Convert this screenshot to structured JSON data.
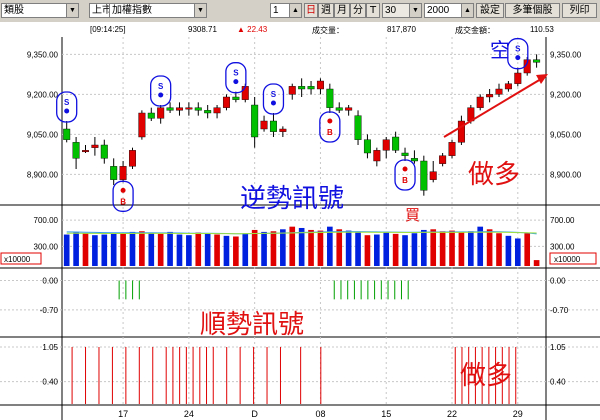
{
  "toolbar": {
    "category_value": "類股",
    "market_value": "上市",
    "index_value": "加權指數",
    "period_num": "1",
    "period_day": "日",
    "period_week": "週",
    "period_month": "月",
    "period_season": "分",
    "period_t": "T",
    "ma_value": "30",
    "count_value": "2000",
    "settings_label": "設定",
    "multi_label": "多筆個股",
    "print_label": "列印"
  },
  "infobar": {
    "time": "[09:14:25]",
    "price": "9308.71",
    "change": "▲ 22.43",
    "volume_label": "成交量：",
    "volume_value": "817,870",
    "amount_label": "成交金額：",
    "amount_value": "110.53"
  },
  "colors": {
    "up": "#e00000",
    "down": "#00c000",
    "vol_blue": "#0020e0",
    "grid": "#c8c8c8",
    "annot_red": "#e01010",
    "annot_blue": "#1010e0"
  },
  "chart_data": {
    "type": "candlestick",
    "price_ticks": [
      "9,350.00",
      "9,200.00",
      "9,050.00",
      "8,900.00"
    ],
    "price_tick_values": [
      9350,
      9200,
      9050,
      8900
    ],
    "price_range": [
      8800,
      9400
    ],
    "x_labels": [
      "17",
      "24",
      "D",
      "08",
      "15",
      "22",
      "29"
    ],
    "x_label_index": [
      6,
      13,
      20,
      27,
      34,
      41,
      48
    ],
    "candles": [
      [
        9070,
        9100,
        9020,
        9030
      ],
      [
        9020,
        9040,
        8920,
        8960
      ],
      [
        8990,
        9010,
        8980,
        8990
      ],
      [
        9000,
        9040,
        8970,
        9010
      ],
      [
        9010,
        9030,
        8940,
        8960
      ],
      [
        8930,
        8960,
        8860,
        8880
      ],
      [
        8880,
        8950,
        8870,
        8930
      ],
      [
        8930,
        9000,
        8920,
        8990
      ],
      [
        9040,
        9140,
        9030,
        9130
      ],
      [
        9130,
        9150,
        9100,
        9110
      ],
      [
        9110,
        9160,
        9090,
        9150
      ],
      [
        9150,
        9170,
        9130,
        9140
      ],
      [
        9140,
        9170,
        9120,
        9150
      ],
      [
        9150,
        9170,
        9120,
        9150
      ],
      [
        9150,
        9170,
        9120,
        9140
      ],
      [
        9140,
        9160,
        9110,
        9130
      ],
      [
        9130,
        9160,
        9110,
        9150
      ],
      [
        9150,
        9200,
        9140,
        9190
      ],
      [
        9190,
        9210,
        9170,
        9180
      ],
      [
        9180,
        9240,
        9170,
        9230
      ],
      [
        9160,
        9190,
        9000,
        9040
      ],
      [
        9070,
        9120,
        9060,
        9100
      ],
      [
        9100,
        9130,
        9040,
        9060
      ],
      [
        9060,
        9080,
        9040,
        9070
      ],
      [
        9200,
        9240,
        9180,
        9230
      ],
      [
        9230,
        9260,
        9190,
        9220
      ],
      [
        9230,
        9250,
        9200,
        9220
      ],
      [
        9220,
        9260,
        9200,
        9250
      ],
      [
        9220,
        9240,
        9130,
        9150
      ],
      [
        9150,
        9170,
        9130,
        9140
      ],
      [
        9140,
        9160,
        9120,
        9150
      ],
      [
        9120,
        9140,
        9010,
        9030
      ],
      [
        9030,
        9050,
        8960,
        8980
      ],
      [
        8950,
        9000,
        8930,
        8990
      ],
      [
        8990,
        9040,
        8960,
        9030
      ],
      [
        9040,
        9060,
        8980,
        8990
      ],
      [
        8980,
        9000,
        8950,
        8970
      ],
      [
        8960,
        8990,
        8940,
        8950
      ],
      [
        8950,
        8970,
        8820,
        8840
      ],
      [
        8880,
        8950,
        8870,
        8910
      ],
      [
        8940,
        8980,
        8930,
        8970
      ],
      [
        8970,
        9030,
        8960,
        9020
      ],
      [
        9020,
        9120,
        9010,
        9100
      ],
      [
        9100,
        9160,
        9090,
        9150
      ],
      [
        9150,
        9200,
        9140,
        9190
      ],
      [
        9190,
        9220,
        9170,
        9200
      ],
      [
        9200,
        9240,
        9190,
        9220
      ],
      [
        9220,
        9250,
        9210,
        9240
      ],
      [
        9240,
        9300,
        9230,
        9280
      ],
      [
        9280,
        9340,
        9270,
        9330
      ],
      [
        9330,
        9350,
        9300,
        9320
      ]
    ],
    "volume_ticks": [
      "700.00",
      "300.00"
    ],
    "volume_tick_values": [
      700,
      300
    ],
    "volume_range": [
      0,
      900
    ],
    "volume_unit": "x10000",
    "volume": [
      [
        480,
        "b"
      ],
      [
        510,
        "b"
      ],
      [
        500,
        "r"
      ],
      [
        470,
        "b"
      ],
      [
        480,
        "b"
      ],
      [
        500,
        "b"
      ],
      [
        490,
        "r"
      ],
      [
        520,
        "b"
      ],
      [
        530,
        "r"
      ],
      [
        500,
        "b"
      ],
      [
        490,
        "r"
      ],
      [
        520,
        "b"
      ],
      [
        480,
        "b"
      ],
      [
        470,
        "b"
      ],
      [
        510,
        "r"
      ],
      [
        500,
        "b"
      ],
      [
        480,
        "r"
      ],
      [
        460,
        "b"
      ],
      [
        450,
        "r"
      ],
      [
        500,
        "b"
      ],
      [
        550,
        "r"
      ],
      [
        520,
        "b"
      ],
      [
        530,
        "r"
      ],
      [
        560,
        "b"
      ],
      [
        600,
        "r"
      ],
      [
        580,
        "b"
      ],
      [
        550,
        "r"
      ],
      [
        540,
        "r"
      ],
      [
        600,
        "b"
      ],
      [
        560,
        "r"
      ],
      [
        540,
        "b"
      ],
      [
        510,
        "b"
      ],
      [
        470,
        "r"
      ],
      [
        480,
        "b"
      ],
      [
        510,
        "b"
      ],
      [
        490,
        "r"
      ],
      [
        470,
        "b"
      ],
      [
        500,
        "b"
      ],
      [
        550,
        "b"
      ],
      [
        560,
        "r"
      ],
      [
        530,
        "r"
      ],
      [
        540,
        "r"
      ],
      [
        520,
        "r"
      ],
      [
        530,
        "b"
      ],
      [
        600,
        "b"
      ],
      [
        560,
        "r"
      ],
      [
        500,
        "r"
      ],
      [
        460,
        "b"
      ],
      [
        420,
        "b"
      ],
      [
        500,
        "r"
      ],
      [
        90,
        "r"
      ]
    ],
    "vol_ma_a": [
      520,
      518,
      515,
      512,
      510,
      508,
      507,
      507,
      508,
      507,
      505,
      505,
      503,
      500,
      500,
      500,
      498,
      495,
      492,
      492,
      495,
      497,
      500,
      503,
      508,
      512,
      515,
      518,
      522,
      524,
      525,
      525,
      523,
      520,
      518,
      517,
      515,
      515,
      517,
      518,
      519,
      520,
      520,
      521,
      523,
      524,
      522,
      518,
      512,
      505,
      490
    ],
    "vol_ma_b": [
      500,
      499,
      498,
      497,
      496,
      495,
      495,
      496,
      497,
      497,
      497,
      497,
      496,
      495,
      495,
      495,
      494,
      493,
      492,
      493,
      495,
      497,
      499,
      501,
      504,
      507,
      509,
      511,
      513,
      514,
      515,
      515,
      514,
      513,
      512,
      512,
      511,
      511,
      512,
      512,
      513,
      513,
      513,
      514,
      515,
      515,
      514,
      512,
      510,
      508,
      503
    ],
    "ind1_ticks": [
      "0.00",
      "-0.70"
    ],
    "ind1_tick_values": [
      0,
      -0.7
    ],
    "ind1_range": [
      -1.3,
      0.25
    ],
    "ind1_signals": [
      8,
      9,
      10,
      11,
      41,
      42,
      43,
      44,
      45,
      46,
      47,
      48,
      49,
      50,
      51
    ],
    "ind1_value": -0.45,
    "ind2_ticks": [
      "1.05",
      "0.40"
    ],
    "ind2_tick_values": [
      1.05,
      0.4
    ],
    "ind2_range": [
      0,
      1.2
    ],
    "ind2_signals": [
      1,
      3,
      5,
      7,
      9,
      11,
      13,
      15,
      16,
      17,
      18,
      19,
      20,
      21,
      22,
      24,
      26,
      28,
      30,
      32,
      35,
      38,
      58,
      59,
      60,
      61,
      62,
      63,
      64,
      65,
      66,
      67
    ],
    "ind2_value": 1.05,
    "markers": [
      {
        "index": 0,
        "kind": "S",
        "color": "blue",
        "pos": "above"
      },
      {
        "index": 10,
        "kind": "B",
        "color": "red",
        "pos": "below"
      },
      {
        "index": 16,
        "kind": "S",
        "color": "blue",
        "pos": "above"
      },
      {
        "index": 28,
        "kind": "S",
        "color": "blue",
        "pos": "above"
      },
      {
        "index": 35,
        "kind": "S",
        "color": "blue",
        "pos": "above"
      },
      {
        "index": 44,
        "kind": "B",
        "color": "red",
        "pos": "below"
      },
      {
        "index": 56,
        "kind": "B",
        "color": "red",
        "pos": "below"
      },
      {
        "index": 76,
        "kind": "S",
        "color": "blue",
        "pos": "above"
      }
    ]
  },
  "annotations": {
    "counter_trend": "逆勢訊號",
    "buy": "買",
    "trend": "順勢訊號",
    "go_long_top": "做多",
    "go_long_bottom": "做多",
    "empty": "空"
  }
}
